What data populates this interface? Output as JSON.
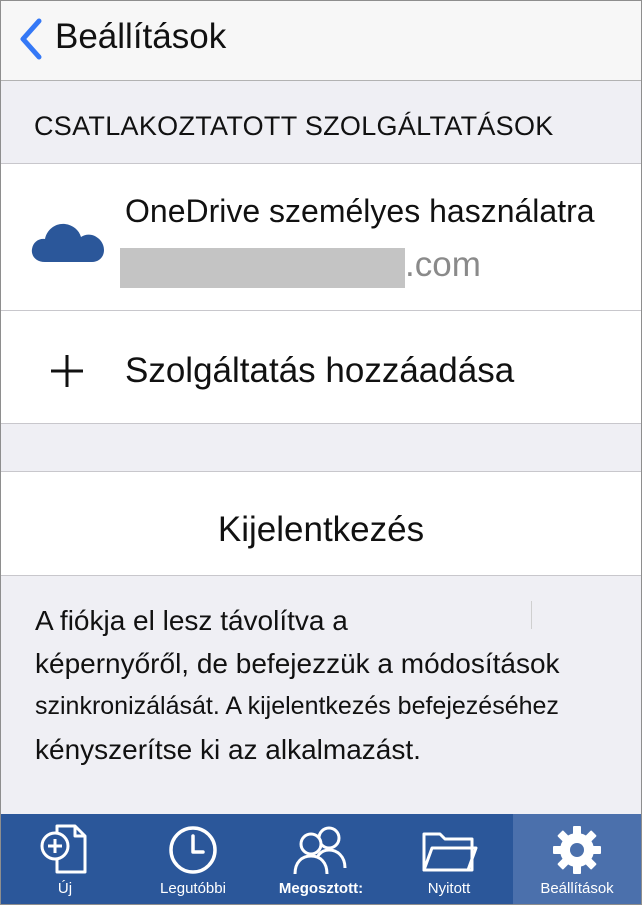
{
  "nav": {
    "back_label": "Beállítások"
  },
  "section": {
    "connected_header": "CSATLAKOZTATOTT SZOLGÁLTATÁSOK"
  },
  "services": [
    {
      "name": "OneDrive személyes használatra",
      "email_suffix": ".com",
      "icon": "onedrive-cloud-icon",
      "icon_color": "#2b579a"
    }
  ],
  "add_service": {
    "label": "Szolgáltatás hozzáadása",
    "icon": "plus-icon"
  },
  "logout": {
    "label": "Kijelentkezés"
  },
  "footer": {
    "line1": "A fiókja el lesz távolítva a",
    "line2": "képernyőről, de befejezzük a módosítások",
    "line3": "szinkronizálását. A kijelentkezés befejezéséhez",
    "line4": "kényszerítse ki az alkalmazást."
  },
  "tabbar": {
    "background": "#2b579a",
    "active_background": "#4b70ac",
    "tabs": [
      {
        "label": "Új",
        "icon": "new-document-icon",
        "active": false
      },
      {
        "label": "Legutóbbi",
        "icon": "clock-icon",
        "active": false
      },
      {
        "label": "Megosztott:",
        "icon": "people-icon",
        "active": false
      },
      {
        "label": "Nyitott",
        "icon": "folder-icon",
        "active": false
      },
      {
        "label": "Beállítások",
        "icon": "gear-icon",
        "active": true
      }
    ]
  },
  "colors": {
    "accent": "#3478f6",
    "grouped_background": "#efeff4"
  }
}
